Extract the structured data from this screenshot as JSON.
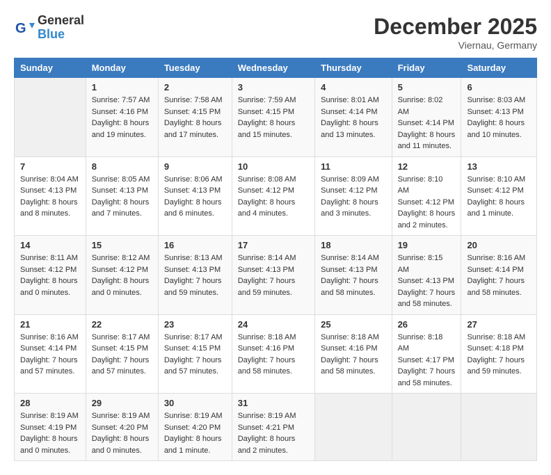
{
  "header": {
    "logo": {
      "line1": "General",
      "line2": "Blue"
    },
    "title": "December 2025",
    "location": "Viernau, Germany"
  },
  "days_of_week": [
    "Sunday",
    "Monday",
    "Tuesday",
    "Wednesday",
    "Thursday",
    "Friday",
    "Saturday"
  ],
  "weeks": [
    [
      {
        "day": "",
        "sunrise": "",
        "sunset": "",
        "daylight": ""
      },
      {
        "day": "1",
        "sunrise": "Sunrise: 7:57 AM",
        "sunset": "Sunset: 4:16 PM",
        "daylight": "Daylight: 8 hours and 19 minutes."
      },
      {
        "day": "2",
        "sunrise": "Sunrise: 7:58 AM",
        "sunset": "Sunset: 4:15 PM",
        "daylight": "Daylight: 8 hours and 17 minutes."
      },
      {
        "day": "3",
        "sunrise": "Sunrise: 7:59 AM",
        "sunset": "Sunset: 4:15 PM",
        "daylight": "Daylight: 8 hours and 15 minutes."
      },
      {
        "day": "4",
        "sunrise": "Sunrise: 8:01 AM",
        "sunset": "Sunset: 4:14 PM",
        "daylight": "Daylight: 8 hours and 13 minutes."
      },
      {
        "day": "5",
        "sunrise": "Sunrise: 8:02 AM",
        "sunset": "Sunset: 4:14 PM",
        "daylight": "Daylight: 8 hours and 11 minutes."
      },
      {
        "day": "6",
        "sunrise": "Sunrise: 8:03 AM",
        "sunset": "Sunset: 4:13 PM",
        "daylight": "Daylight: 8 hours and 10 minutes."
      }
    ],
    [
      {
        "day": "7",
        "sunrise": "Sunrise: 8:04 AM",
        "sunset": "Sunset: 4:13 PM",
        "daylight": "Daylight: 8 hours and 8 minutes."
      },
      {
        "day": "8",
        "sunrise": "Sunrise: 8:05 AM",
        "sunset": "Sunset: 4:13 PM",
        "daylight": "Daylight: 8 hours and 7 minutes."
      },
      {
        "day": "9",
        "sunrise": "Sunrise: 8:06 AM",
        "sunset": "Sunset: 4:13 PM",
        "daylight": "Daylight: 8 hours and 6 minutes."
      },
      {
        "day": "10",
        "sunrise": "Sunrise: 8:08 AM",
        "sunset": "Sunset: 4:12 PM",
        "daylight": "Daylight: 8 hours and 4 minutes."
      },
      {
        "day": "11",
        "sunrise": "Sunrise: 8:09 AM",
        "sunset": "Sunset: 4:12 PM",
        "daylight": "Daylight: 8 hours and 3 minutes."
      },
      {
        "day": "12",
        "sunrise": "Sunrise: 8:10 AM",
        "sunset": "Sunset: 4:12 PM",
        "daylight": "Daylight: 8 hours and 2 minutes."
      },
      {
        "day": "13",
        "sunrise": "Sunrise: 8:10 AM",
        "sunset": "Sunset: 4:12 PM",
        "daylight": "Daylight: 8 hours and 1 minute."
      }
    ],
    [
      {
        "day": "14",
        "sunrise": "Sunrise: 8:11 AM",
        "sunset": "Sunset: 4:12 PM",
        "daylight": "Daylight: 8 hours and 0 minutes."
      },
      {
        "day": "15",
        "sunrise": "Sunrise: 8:12 AM",
        "sunset": "Sunset: 4:12 PM",
        "daylight": "Daylight: 8 hours and 0 minutes."
      },
      {
        "day": "16",
        "sunrise": "Sunrise: 8:13 AM",
        "sunset": "Sunset: 4:13 PM",
        "daylight": "Daylight: 7 hours and 59 minutes."
      },
      {
        "day": "17",
        "sunrise": "Sunrise: 8:14 AM",
        "sunset": "Sunset: 4:13 PM",
        "daylight": "Daylight: 7 hours and 59 minutes."
      },
      {
        "day": "18",
        "sunrise": "Sunrise: 8:14 AM",
        "sunset": "Sunset: 4:13 PM",
        "daylight": "Daylight: 7 hours and 58 minutes."
      },
      {
        "day": "19",
        "sunrise": "Sunrise: 8:15 AM",
        "sunset": "Sunset: 4:13 PM",
        "daylight": "Daylight: 7 hours and 58 minutes."
      },
      {
        "day": "20",
        "sunrise": "Sunrise: 8:16 AM",
        "sunset": "Sunset: 4:14 PM",
        "daylight": "Daylight: 7 hours and 58 minutes."
      }
    ],
    [
      {
        "day": "21",
        "sunrise": "Sunrise: 8:16 AM",
        "sunset": "Sunset: 4:14 PM",
        "daylight": "Daylight: 7 hours and 57 minutes."
      },
      {
        "day": "22",
        "sunrise": "Sunrise: 8:17 AM",
        "sunset": "Sunset: 4:15 PM",
        "daylight": "Daylight: 7 hours and 57 minutes."
      },
      {
        "day": "23",
        "sunrise": "Sunrise: 8:17 AM",
        "sunset": "Sunset: 4:15 PM",
        "daylight": "Daylight: 7 hours and 57 minutes."
      },
      {
        "day": "24",
        "sunrise": "Sunrise: 8:18 AM",
        "sunset": "Sunset: 4:16 PM",
        "daylight": "Daylight: 7 hours and 58 minutes."
      },
      {
        "day": "25",
        "sunrise": "Sunrise: 8:18 AM",
        "sunset": "Sunset: 4:16 PM",
        "daylight": "Daylight: 7 hours and 58 minutes."
      },
      {
        "day": "26",
        "sunrise": "Sunrise: 8:18 AM",
        "sunset": "Sunset: 4:17 PM",
        "daylight": "Daylight: 7 hours and 58 minutes."
      },
      {
        "day": "27",
        "sunrise": "Sunrise: 8:18 AM",
        "sunset": "Sunset: 4:18 PM",
        "daylight": "Daylight: 7 hours and 59 minutes."
      }
    ],
    [
      {
        "day": "28",
        "sunrise": "Sunrise: 8:19 AM",
        "sunset": "Sunset: 4:19 PM",
        "daylight": "Daylight: 8 hours and 0 minutes."
      },
      {
        "day": "29",
        "sunrise": "Sunrise: 8:19 AM",
        "sunset": "Sunset: 4:20 PM",
        "daylight": "Daylight: 8 hours and 0 minutes."
      },
      {
        "day": "30",
        "sunrise": "Sunrise: 8:19 AM",
        "sunset": "Sunset: 4:20 PM",
        "daylight": "Daylight: 8 hours and 1 minute."
      },
      {
        "day": "31",
        "sunrise": "Sunrise: 8:19 AM",
        "sunset": "Sunset: 4:21 PM",
        "daylight": "Daylight: 8 hours and 2 minutes."
      },
      {
        "day": "",
        "sunrise": "",
        "sunset": "",
        "daylight": ""
      },
      {
        "day": "",
        "sunrise": "",
        "sunset": "",
        "daylight": ""
      },
      {
        "day": "",
        "sunrise": "",
        "sunset": "",
        "daylight": ""
      }
    ]
  ]
}
